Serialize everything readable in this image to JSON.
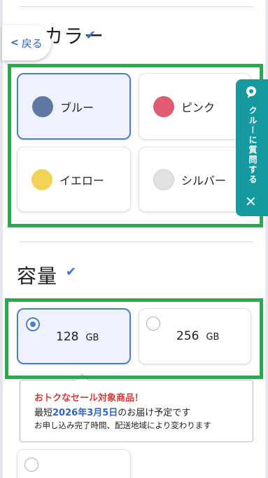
{
  "nav": {
    "back_label": "戻る"
  },
  "color_section": {
    "title": "カラー",
    "options": [
      {
        "label": "ブルー",
        "color": "#6178a3",
        "selected": true
      },
      {
        "label": "ピンク",
        "color": "#e05c70",
        "selected": false
      },
      {
        "label": "イエロー",
        "color": "#f1d358",
        "selected": false
      },
      {
        "label": "シルバー",
        "color": "#e2e2e4",
        "selected": false
      }
    ]
  },
  "capacity_section": {
    "title": "容量",
    "options": [
      {
        "value": "128",
        "unit": "GB",
        "selected": true
      },
      {
        "value": "256",
        "unit": "GB",
        "selected": false
      }
    ]
  },
  "notice": {
    "headline": "おトクなセール対象商品！",
    "delivery_prefix": "最短",
    "delivery_date": "2026年3月5日",
    "delivery_suffix": "のお届け予定です",
    "note": "お申し込み完了時間、配送地域により変わります"
  },
  "side_tab": {
    "label": "クルーに質問する"
  },
  "colors": {
    "accent": "#4a7ed6",
    "highlight": "#1fb04a",
    "sale_red": "#d63b3b",
    "teal": "#159aa0"
  }
}
